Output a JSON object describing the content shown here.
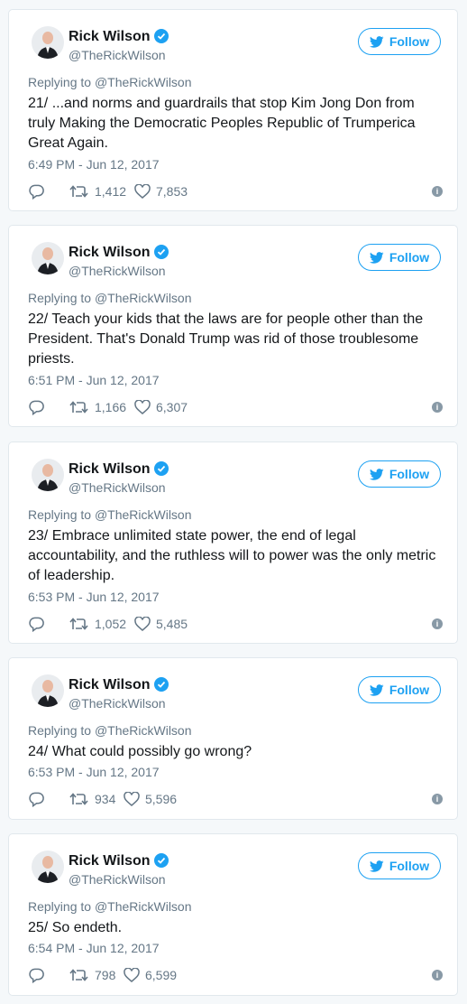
{
  "colors": {
    "accent": "#1da1f2",
    "secondary_text": "#657786",
    "border": "#e1e8ed"
  },
  "tweets": [
    {
      "name": "Rick Wilson",
      "handle": "@TheRickWilson",
      "follow_label": "Follow",
      "replying_prefix": "Replying to",
      "replying_handle": "@TheRickWilson",
      "text": "21/ ...and norms and guardrails that stop Kim Jong Don from truly Making the Democratic Peoples Republic of Trumperica Great Again.",
      "time": "6:49 PM - Jun 12, 2017",
      "retweets": "1,412",
      "likes": "7,853"
    },
    {
      "name": "Rick Wilson",
      "handle": "@TheRickWilson",
      "follow_label": "Follow",
      "replying_prefix": "Replying to",
      "replying_handle": "@TheRickWilson",
      "text": "22/ Teach your kids that the laws are for people other than the President. That's Donald Trump was rid of those troublesome priests.",
      "time": "6:51 PM - Jun 12, 2017",
      "retweets": "1,166",
      "likes": "6,307"
    },
    {
      "name": "Rick Wilson",
      "handle": "@TheRickWilson",
      "follow_label": "Follow",
      "replying_prefix": "Replying to",
      "replying_handle": "@TheRickWilson",
      "text": "23/ Embrace unlimited state power, the end of legal accountability, and the ruthless will to power was the only metric of leadership.",
      "time": "6:53 PM - Jun 12, 2017",
      "retweets": "1,052",
      "likes": "5,485"
    },
    {
      "name": "Rick Wilson",
      "handle": "@TheRickWilson",
      "follow_label": "Follow",
      "replying_prefix": "Replying to",
      "replying_handle": "@TheRickWilson",
      "text": "24/ What could possibly go wrong?",
      "time": "6:53 PM - Jun 12, 2017",
      "retweets": "934",
      "likes": "5,596"
    },
    {
      "name": "Rick Wilson",
      "handle": "@TheRickWilson",
      "follow_label": "Follow",
      "replying_prefix": "Replying to",
      "replying_handle": "@TheRickWilson",
      "text": "25/ So endeth.",
      "time": "6:54 PM - Jun 12, 2017",
      "retweets": "798",
      "likes": "6,599"
    }
  ]
}
